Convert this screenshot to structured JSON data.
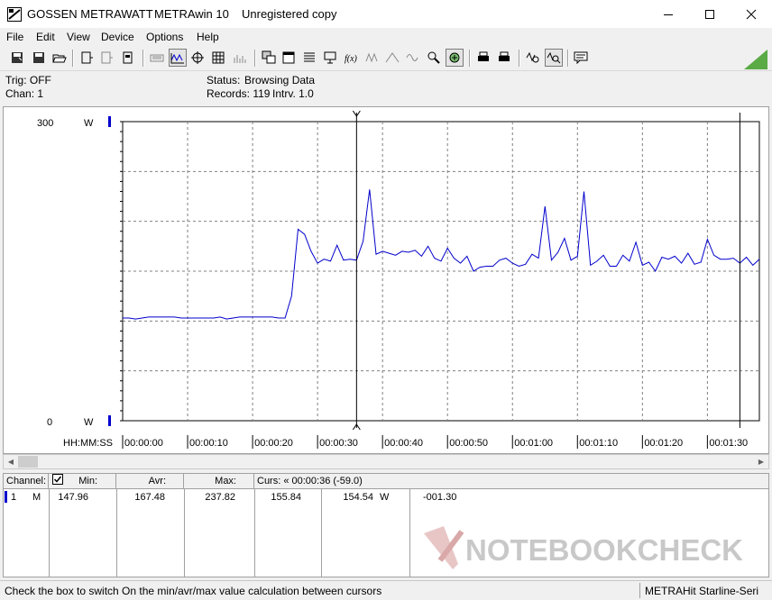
{
  "window": {
    "brand": "GOSSEN METRAWATT",
    "app": "METRAwin 10",
    "license": "Unregistered copy"
  },
  "menu": [
    "File",
    "Edit",
    "View",
    "Device",
    "Options",
    "Help"
  ],
  "info": {
    "trig": "Trig: OFF",
    "chan": "Chan:  1",
    "status_label": "Status:",
    "status_value": "Browsing Data",
    "records": "Records: 119",
    "interval": "Intrv. 1.0"
  },
  "chart_data": {
    "type": "line",
    "y_top_label": "300",
    "y_bottom_label": "0",
    "y_unit": "W",
    "ylim": [
      0,
      300
    ],
    "time_axis_label": "HH:MM:SS",
    "x_ticks": [
      "00:00:00",
      "00:00:10",
      "00:00:20",
      "00:00:30",
      "00:00:40",
      "00:00:50",
      "00:01:00",
      "00:01:10",
      "00:01:20",
      "00:01:30"
    ],
    "xlim": [
      0,
      98
    ],
    "grid": true,
    "cursors": [
      36,
      95
    ],
    "series": [
      {
        "color": "#0000cc",
        "x": [
          0,
          1,
          2,
          3,
          4,
          5,
          6,
          7,
          8,
          9,
          10,
          11,
          12,
          13,
          14,
          15,
          16,
          17,
          18,
          19,
          20,
          21,
          22,
          23,
          24,
          25,
          26,
          27,
          28,
          29,
          30,
          31,
          32,
          33,
          34,
          35,
          36,
          37,
          38,
          39,
          40,
          41,
          42,
          43,
          44,
          45,
          46,
          47,
          48,
          49,
          50,
          51,
          52,
          53,
          54,
          55,
          56,
          57,
          58,
          59,
          60,
          61,
          62,
          63,
          64,
          65,
          66,
          67,
          68,
          69,
          70,
          71,
          72,
          73,
          74,
          75,
          76,
          77,
          78,
          79,
          80,
          81,
          82,
          83,
          84,
          85,
          86,
          87,
          88,
          89,
          90,
          91,
          92,
          93,
          94,
          95,
          96,
          97,
          98
        ],
        "y": [
          103,
          103,
          102,
          103,
          104,
          104,
          104,
          104,
          104,
          103,
          103,
          103,
          103,
          103,
          103,
          104,
          102,
          103,
          104,
          104,
          104,
          104,
          104,
          104,
          103,
          103,
          125,
          192,
          187,
          170,
          158,
          162,
          160,
          176,
          161,
          162,
          161,
          180,
          232,
          167,
          170,
          168,
          166,
          170,
          169,
          171,
          165,
          175,
          163,
          160,
          173,
          163,
          158,
          165,
          150,
          154,
          155,
          155,
          161,
          163,
          158,
          155,
          157,
          167,
          163,
          215,
          161,
          169,
          183,
          161,
          165,
          230,
          156,
          160,
          166,
          155,
          155,
          166,
          160,
          179,
          156,
          159,
          150,
          164,
          162,
          165,
          158,
          168,
          157,
          159,
          182,
          166,
          162,
          162,
          163,
          158,
          164,
          156,
          162
        ]
      }
    ]
  },
  "table": {
    "headers": {
      "channel": "Channel:",
      "min": "Min:",
      "avr": "Avr:",
      "max": "Max:",
      "curs": "Curs: « 00:00:36 (-59.0)"
    },
    "row": {
      "channel_no": "1",
      "mode": "M",
      "min": "147.96",
      "avr": "167.48",
      "max": "237.82",
      "curs1": "155.84",
      "curs2": "154.54",
      "unit": "W",
      "delta": "-001.30"
    }
  },
  "status": {
    "hint": "Check the box to switch On the min/avr/max value calculation between cursors",
    "device": "METRAHit Starline-Seri"
  },
  "watermark": "NOTEBOOKCHECK",
  "colors": {
    "accent": "#0000cc",
    "status_triangle": "#5aaa46"
  }
}
